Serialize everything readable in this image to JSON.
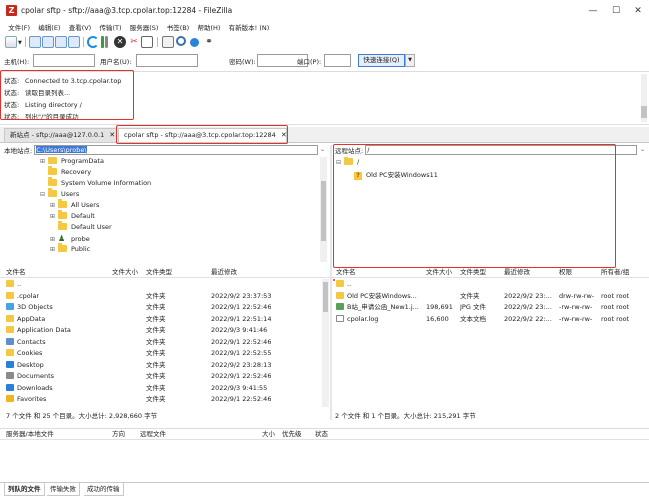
{
  "window": {
    "app_icon_letter": "Z",
    "title": "cpolar sftp - sftp://aaa@3.tcp.cpolar.top:12284 - FileZilla",
    "minimize": "—",
    "maximize": "☐",
    "close": "✕"
  },
  "menu": [
    "文件(F)",
    "编辑(E)",
    "查看(V)",
    "传输(T)",
    "服务器(S)",
    "书签(B)",
    "帮助(H)",
    "有新版本! (N)"
  ],
  "quickconnect": {
    "host_label": "主机(H):",
    "user_label": "用户名(U):",
    "pass_label": "密码(W):",
    "port_label": "端口(P):",
    "host_value": "",
    "user_value": "",
    "pass_value": "",
    "port_value": "",
    "connect_label": "快速连接(Q)",
    "dropdown_icon": "▼"
  },
  "log": [
    {
      "label": "状态:",
      "text": "Connected to 3.tcp.cpolar.top"
    },
    {
      "label": "状态:",
      "text": "读取目录列表..."
    },
    {
      "label": "状态:",
      "text": "Listing directory /"
    },
    {
      "label": "状态:",
      "text": "列出\"/\"的目录成功"
    }
  ],
  "tabs": [
    {
      "label": "新站点 - sftp://aaa@127.0.0.1",
      "close": "✕"
    },
    {
      "label": "cpolar sftp - sftp://aaa@3.tcp.cpolar.top:12284",
      "close": "✕"
    }
  ],
  "local": {
    "site_label": "本地站点:",
    "site_path": "C:\\Users\\probe\\",
    "tree": [
      {
        "label": "ProgramData",
        "expander": "⊞"
      },
      {
        "label": "Recovery",
        "expander": ""
      },
      {
        "label": "System Volume Information",
        "expander": ""
      },
      {
        "label": "Users",
        "expander": "⊟"
      },
      {
        "label": "All Users",
        "expander": "⊞"
      },
      {
        "label": "Default",
        "expander": "⊞"
      },
      {
        "label": "Default User",
        "expander": ""
      },
      {
        "label": "probe",
        "expander": "⊞"
      },
      {
        "label": "Public",
        "expander": "⊞"
      }
    ],
    "headers": {
      "name": "文件名",
      "size": "文件大小",
      "type": "文件类型",
      "modified": "最近修改"
    },
    "files": [
      {
        "name": "..",
        "size": "",
        "type": "",
        "modified": "",
        "icon": "folder"
      },
      {
        "name": ".cpolar",
        "size": "",
        "type": "文件夹",
        "modified": "2022/9/2 23:37:53",
        "icon": "folder"
      },
      {
        "name": "3D Objects",
        "size": "",
        "type": "文件夹",
        "modified": "2022/9/1 22:52:46",
        "icon": "cube"
      },
      {
        "name": "AppData",
        "size": "",
        "type": "文件夹",
        "modified": "2022/9/1 22:51:14",
        "icon": "folder"
      },
      {
        "name": "Application Data",
        "size": "",
        "type": "文件夹",
        "modified": "2022/9/3 9:41:46",
        "icon": "folder"
      },
      {
        "name": "Contacts",
        "size": "",
        "type": "文件夹",
        "modified": "2022/9/1 22:52:46",
        "icon": "contacts"
      },
      {
        "name": "Cookies",
        "size": "",
        "type": "文件夹",
        "modified": "2022/9/1 22:52:55",
        "icon": "folder"
      },
      {
        "name": "Desktop",
        "size": "",
        "type": "文件夹",
        "modified": "2022/9/2 23:28:13",
        "icon": "desktop"
      },
      {
        "name": "Documents",
        "size": "",
        "type": "文件夹",
        "modified": "2022/9/1 22:52:46",
        "icon": "documents"
      },
      {
        "name": "Downloads",
        "size": "",
        "type": "文件夹",
        "modified": "2022/9/3 9:41:55",
        "icon": "downloads"
      },
      {
        "name": "Favorites",
        "size": "",
        "type": "文件夹",
        "modified": "2022/9/1 22:52:46",
        "icon": "star"
      }
    ],
    "status": "7 个文件 和 25 个目录。大小总计: 2,928,660 字节"
  },
  "remote": {
    "site_label": "远程站点:",
    "site_path": "/",
    "tree": [
      {
        "label": "/",
        "expander": "⊟"
      },
      {
        "label": "Old PC安装Windows11",
        "expander": ""
      }
    ],
    "headers": {
      "name": "文件名",
      "size": "文件大小",
      "type": "文件类型",
      "modified": "最近修改",
      "perm": "权限",
      "owner": "所有者/组"
    },
    "files": [
      {
        "name": "..",
        "size": "",
        "type": "",
        "modified": "",
        "perm": "",
        "owner": "",
        "icon": "folder"
      },
      {
        "name": "Old PC安装Windows...",
        "size": "",
        "type": "文件夹",
        "modified": "2022/9/2 23:...",
        "perm": "drw-rw-rw-",
        "owner": "root root",
        "icon": "folder"
      },
      {
        "name": "B站_申请公函_New1.j...",
        "size": "198,691",
        "type": "JPG 文件",
        "modified": "2022/9/2 23:...",
        "perm": "-rw-rw-rw-",
        "owner": "root root",
        "icon": "image"
      },
      {
        "name": "cpolar.log",
        "size": "16,600",
        "type": "文本文档",
        "modified": "2022/9/2 22:...",
        "perm": "-rw-rw-rw-",
        "owner": "root root",
        "icon": "doc"
      }
    ],
    "status": "2 个文件 和 1 个目录。大小总计: 215,291 字节"
  },
  "queue": {
    "headers": [
      "服务器/本地文件",
      "方向",
      "远程文件",
      "大小",
      "优先级",
      "状态"
    ]
  },
  "bottom_tabs": [
    "列队的文件",
    "传输失败",
    "成功的传输"
  ],
  "colors": {
    "accent_red": "#e2322e",
    "folder": "#f5c842",
    "selection": "#3b78d8"
  }
}
